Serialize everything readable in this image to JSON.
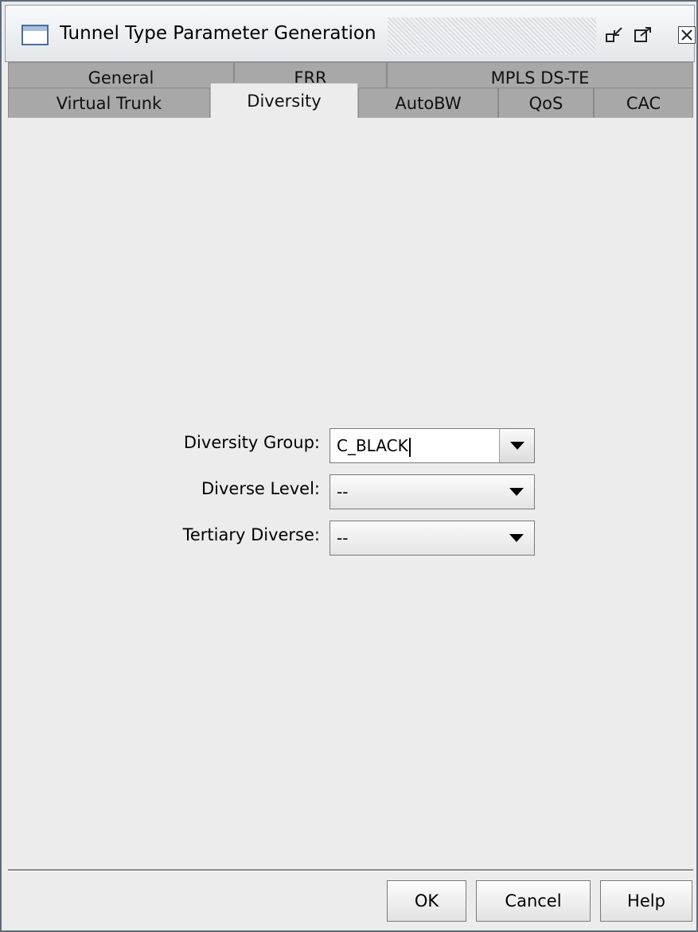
{
  "window": {
    "title": "Tunnel Type Parameter Generation"
  },
  "tabs": {
    "row_back": [
      "General",
      "FRR",
      "MPLS DS-TE"
    ],
    "row_front": [
      "Virtual Trunk",
      "Diversity",
      "AutoBW",
      "QoS",
      "CAC"
    ],
    "active": "Diversity"
  },
  "form": {
    "diversity_group": {
      "label": "Diversity Group:",
      "value": "C_BLACK"
    },
    "diverse_level": {
      "label": "Diverse Level:",
      "value": "--"
    },
    "tertiary_diverse": {
      "label": "Tertiary Diverse:",
      "value": "--"
    }
  },
  "buttons": {
    "ok": "OK",
    "cancel": "Cancel",
    "help": "Help"
  }
}
